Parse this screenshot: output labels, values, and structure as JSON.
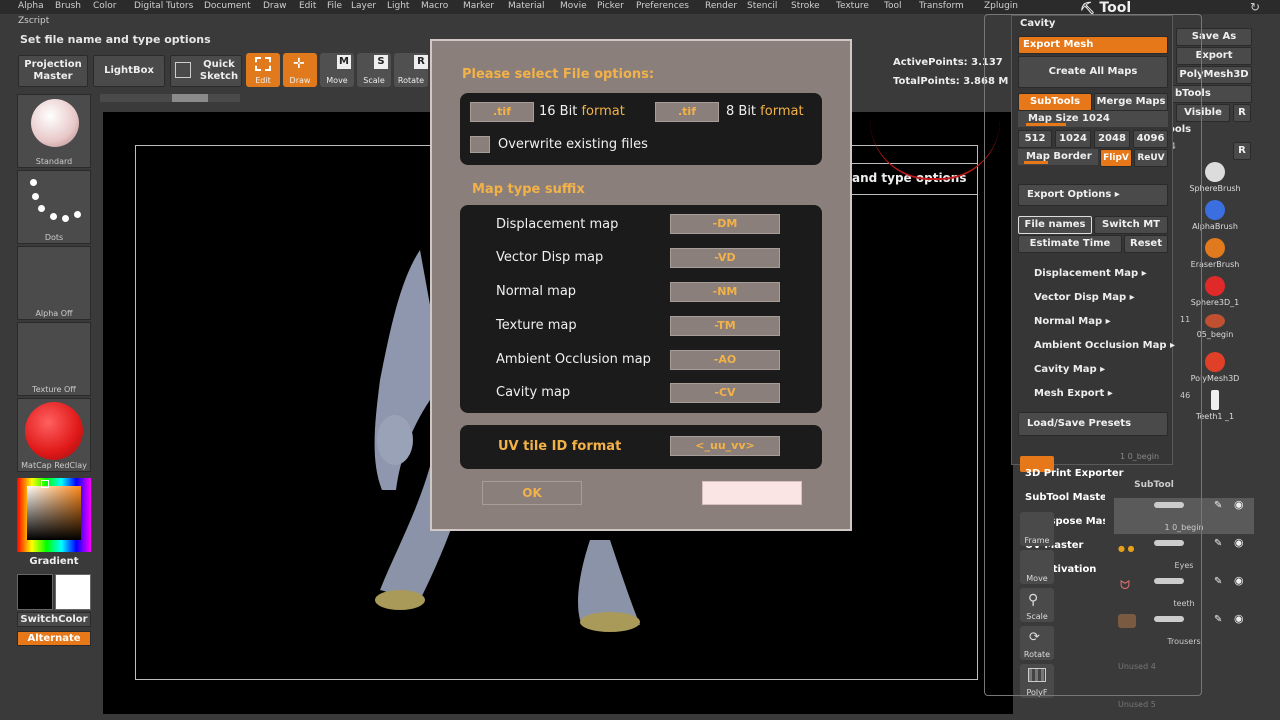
{
  "menubar": [
    "Alpha",
    "Brush",
    "Color",
    "Digital Tutors",
    "Document",
    "Draw",
    "Edit",
    "File",
    "Layer",
    "Light",
    "Macro",
    "Marker",
    "Material",
    "Movie",
    "Picker",
    "Preferences",
    "Render",
    "Stencil",
    "Stroke",
    "Texture",
    "Tool",
    "Transform",
    "Zplugin"
  ],
  "zscript": "Zscript",
  "hint": "Set file name and type options",
  "toolbar": {
    "projection_master": "Projection Master",
    "lightbox": "LightBox",
    "quick_sketch": "Quick Sketch",
    "edit": "Edit",
    "draw": "Draw",
    "move": "Move",
    "scale": "Scale",
    "rotate": "Rotate",
    "move_key": "M",
    "scale_key": "S",
    "rotate_key": "R"
  },
  "counters": {
    "active_points": "ActivePoints: 3.137",
    "total_points": "TotalPoints: 3.868 M"
  },
  "left_shelf": {
    "standard": "Standard",
    "dots": "Dots",
    "alpha": "Alpha  Off",
    "texture": "Texture  Off",
    "matcap": "MatCap  RedClay",
    "gradient": "Gradient",
    "switch_color": "SwitchColor",
    "alternate": "Alternate"
  },
  "viewport_tooltip": "and type options",
  "dialog": {
    "title": "Please select File options:",
    "chip16": ".tif",
    "label16_num": "16 Bit ",
    "label16_fmt": "format",
    "chip8": ".tif",
    "label8_num": "8 Bit ",
    "label8_fmt": "format",
    "overwrite": "Overwrite existing files",
    "suffix_header": "Map type suffix",
    "maps": [
      {
        "name": "Displacement map",
        "suffix": "-DM"
      },
      {
        "name": "Vector Disp map",
        "suffix": "-VD"
      },
      {
        "name": "Normal map",
        "suffix": "-NM"
      },
      {
        "name": "Texture map",
        "suffix": "-TM"
      },
      {
        "name": "Ambient Occlusion map",
        "suffix": "-AO"
      },
      {
        "name": "Cavity map",
        "suffix": "-CV"
      }
    ],
    "uv_label": "UV tile ID format",
    "uv_value": "<_uu_vv>",
    "ok": "OK",
    "cancel": ""
  },
  "tool_title": "Tool",
  "right_panel": {
    "cavity": "Cavity",
    "export_mesh": "Export Mesh",
    "create_all_maps": "Create All Maps",
    "subtools": "SubTools",
    "merge_maps": "Merge Maps",
    "map_size": "Map Size 1024",
    "size_512": "512",
    "size_1024": "1024",
    "size_2048": "2048",
    "size_4096": "4096",
    "map_border": "Map Border",
    "flipv": "FlipV",
    "reuv": "ReUV",
    "export_options": "Export Options",
    "file_names": "File names",
    "switch_mt": "Switch MT",
    "estimate_time": "Estimate Time",
    "reset": "Reset",
    "submenus": [
      "Displacement Map",
      "Vector Disp Map",
      "Normal Map",
      "Ambient Occlusion Map",
      "Cavity Map",
      "Mesh Export"
    ],
    "load_save": "Load/Save Presets"
  },
  "far_right": {
    "save_as": "Save As",
    "export": "Export",
    "polymesh3d": "PolyMesh3D",
    "subtools_frag": "bTools",
    "visible": "Visible",
    "r1": "R",
    "tools_frag": "ools",
    "num4": "4",
    "r2": "R"
  },
  "brushes": [
    {
      "name": "SphereBrush",
      "color": "#dcdcdc"
    },
    {
      "name": "AlphaBrush",
      "color": "#3b6fe0"
    },
    {
      "name": "EraserBrush",
      "color": "#e07a1c"
    },
    {
      "name": "Sphere3D_1",
      "color": "#e02a2a"
    },
    {
      "name": "05_begin",
      "color": "#c05030"
    },
    {
      "name": "PolyMesh3D",
      "color": "#e04028"
    },
    {
      "name": "Teeth1 _1",
      "color": "#f0f0f0"
    }
  ],
  "brush_nums": {
    "n11": "11",
    "n46": "46"
  },
  "overlay_menu": {
    "print": "3D Print Exporter",
    "subtool_master": "SubTool Master",
    "transpose": "Transpose Master",
    "uv_master": "UV Master",
    "deactivation": "Deactivation",
    "begin": "1 0_begin"
  },
  "subtool_panel": {
    "header": "SubTool",
    "rows": [
      "1 0_begin",
      "Eyes",
      "teeth",
      "Trousers",
      "Unused  4",
      "Unused  5"
    ]
  },
  "view_buttons": [
    "Frame",
    "Move",
    "Scale",
    "Rotate",
    "PolyF"
  ]
}
